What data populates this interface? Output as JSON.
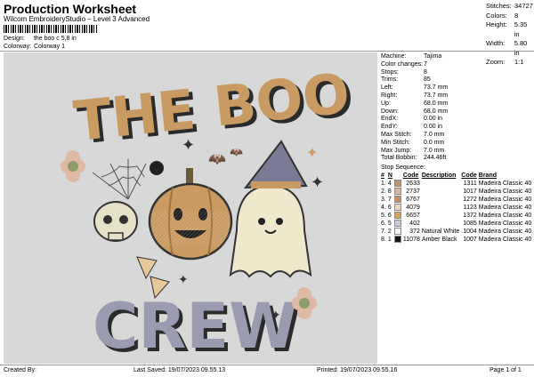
{
  "header": {
    "title": "Production Worksheet",
    "subtitle": "Wilcom EmbroideryStudio – Level 3 Advanced",
    "design_label": "Design:",
    "design_value": "the boo c 5,8 in",
    "colorway_label": "Colorway:",
    "colorway_value": "Colorway 1"
  },
  "summary": [
    {
      "label": "Stitches:",
      "value": "34727"
    },
    {
      "label": "Colors:",
      "value": "8"
    },
    {
      "label": "Height:",
      "value": "5.35 in"
    },
    {
      "label": "Width:",
      "value": "5.80 in"
    },
    {
      "label": "Zoom:",
      "value": "1:1"
    }
  ],
  "properties": [
    {
      "label": "Machine:",
      "value": "Tajima"
    },
    {
      "label": "Color changes:",
      "value": "7"
    },
    {
      "label": "Stops:",
      "value": "8"
    },
    {
      "label": "Trims:",
      "value": "85"
    },
    {
      "label": "Left:",
      "value": "73.7 mm"
    },
    {
      "label": "Right:",
      "value": "73.7 mm"
    },
    {
      "label": "Up:",
      "value": "68.0 mm"
    },
    {
      "label": "Down:",
      "value": "68.0 mm"
    },
    {
      "label": "EndX:",
      "value": "0.00 in"
    },
    {
      "label": "EndY:",
      "value": "0.00 in"
    },
    {
      "label": "Max Stitch:",
      "value": "7.0 mm"
    },
    {
      "label": "Min Stitch:",
      "value": "0.0 mm"
    },
    {
      "label": "Max Jump:",
      "value": "7.0 mm"
    },
    {
      "label": "Total Bobbin:",
      "value": "244.46ft"
    }
  ],
  "stop_sequence": {
    "label": "Stop Sequence:",
    "columns": [
      "#",
      "N",
      "Code",
      "Description",
      "Code",
      "Brand"
    ],
    "rows": [
      {
        "stop": "1.",
        "n": "4",
        "color": "#b9966a",
        "code": "2633",
        "desc": "",
        "code2": "1311",
        "brand": "Madeira Classic 40"
      },
      {
        "stop": "2.",
        "n": "8",
        "color": "#d9b8a4",
        "code": "2737",
        "desc": "",
        "code2": "1017",
        "brand": "Madeira Classic 40"
      },
      {
        "stop": "3.",
        "n": "7",
        "color": "#c58f6a",
        "code": "6767",
        "desc": "",
        "code2": "1272",
        "brand": "Madeira Classic 40"
      },
      {
        "stop": "4.",
        "n": "6",
        "color": "#e8d6c6",
        "code": "4079",
        "desc": "",
        "code2": "1123",
        "brand": "Madeira Classic 40"
      },
      {
        "stop": "5.",
        "n": "6",
        "color": "#d7a35a",
        "code": "6657",
        "desc": "",
        "code2": "1372",
        "brand": "Madeira Classic 40"
      },
      {
        "stop": "6.",
        "n": "5",
        "color": "#c8c8d8",
        "code": "402",
        "desc": "",
        "code2": "1085",
        "brand": "Madeira Classic 40"
      },
      {
        "stop": "7.",
        "n": "2",
        "color": "#f4f4f4",
        "code": "372",
        "desc": "Natural White",
        "code2": "1004",
        "brand": "Madeira Classic 40"
      },
      {
        "stop": "8.",
        "n": "1",
        "color": "#141414",
        "code": "11078",
        "desc": "Amber Black",
        "code2": "1007",
        "brand": "Madeira Classic 40"
      }
    ]
  },
  "design": {
    "line1": "THE BOO",
    "line2": "CREW"
  },
  "footer": {
    "created_by": "Created By:",
    "last_saved": "Last Saved: 19/07/2023 09.55.13",
    "printed": "Printed: 19/07/2023 09.55.16",
    "page": "Page 1 of 1"
  }
}
